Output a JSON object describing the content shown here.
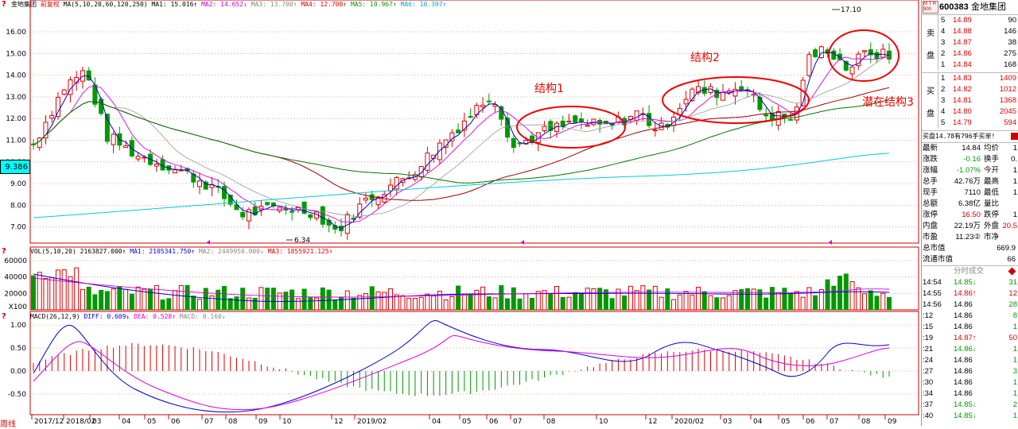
{
  "chart_header": {
    "stock_name": "金地集团",
    "adjust_flag": "前复权",
    "ma_label": "MA(5,10,20,60,120,250)",
    "ma1": "MA1: 15.016↑",
    "ma2": "MA2: 14.652↓",
    "ma3": "MA3: 13.700↑",
    "ma4": "MA4: 12.708↑",
    "ma5": "MA5: 10.967↑",
    "ma6": "MA6: 10.397↑"
  },
  "price_axis": [
    "16.00",
    "15.00",
    "14.00",
    "13.00",
    "12.00",
    "11.00",
    "10.00",
    "9.00",
    "8.00",
    "7.00"
  ],
  "current_price_tag": "9.386",
  "high_marker": "17.10",
  "low_marker": "6.34",
  "annotations": {
    "s1": "结构1",
    "s2": "结构2",
    "s3": "潜在结构3"
  },
  "vol_header": {
    "label": "VOL(5,10,20)",
    "vol": "2163827.000↑",
    "ma1": "MA1: 2105341.750↑",
    "ma2": "MA2: 2449950.000↓",
    "ma3": "MA3: 1855921.125↑"
  },
  "vol_axis": [
    "60000",
    "40000",
    "20000",
    "X100"
  ],
  "macd_header": {
    "label": "MACD(26,12,9)",
    "diff": "DIFF: 0.609↓",
    "dea": "DEA: 0.528↑",
    "macd": "MACD: 0.160↓"
  },
  "macd_axis": [
    "1.00",
    "0.50",
    "0.00",
    "-0.50"
  ],
  "time_axis": [
    {
      "label": "2017/12"
    },
    {
      "label": "2018/02"
    },
    {
      "label": "03"
    },
    {
      "label": "04"
    },
    {
      "label": "05"
    },
    {
      "label": "06"
    },
    {
      "label": "07"
    },
    {
      "label": "08"
    },
    {
      "label": "09"
    },
    {
      "label": "10"
    },
    {
      "label": "12"
    },
    {
      "label": "2019/02"
    },
    {
      "label": "04"
    },
    {
      "label": "05"
    },
    {
      "label": "06"
    },
    {
      "label": "07"
    },
    {
      "label": "08"
    },
    {
      "label": "10"
    },
    {
      "label": "12"
    },
    {
      "label": "2020/02"
    },
    {
      "label": "03"
    },
    {
      "label": "04"
    },
    {
      "label": "05"
    },
    {
      "label": "06"
    },
    {
      "label": "07"
    },
    {
      "label": "08"
    },
    {
      "label": "09"
    }
  ],
  "period_label": "周线",
  "side": {
    "code": "600383",
    "name": "金地集团",
    "sell_label_1": "卖",
    "sell_label_2": "盘",
    "buy_label_1": "买",
    "buy_label_2": "盘",
    "asks": [
      {
        "lvl": "5",
        "price": "14.89",
        "vol": "90"
      },
      {
        "lvl": "4",
        "price": "14.88",
        "vol": "146"
      },
      {
        "lvl": "3",
        "price": "14.87",
        "vol": "38"
      },
      {
        "lvl": "2",
        "price": "14.86",
        "vol": "275"
      },
      {
        "lvl": "1",
        "price": "14.84",
        "vol": "168"
      }
    ],
    "bids": [
      {
        "lvl": "1",
        "price": "14.83",
        "vol": "1409"
      },
      {
        "lvl": "2",
        "price": "14.82",
        "vol": "1012"
      },
      {
        "lvl": "3",
        "price": "14.81",
        "vol": "1368"
      },
      {
        "lvl": "4",
        "price": "14.80",
        "vol": "2045"
      },
      {
        "lvl": "5",
        "price": "14.79",
        "vol": "594"
      }
    ],
    "order_note": "买盘14.78有796手买单!",
    "stats": [
      {
        "k1": "最新",
        "v1": "14.84",
        "k2": "均价",
        "v2": "1"
      },
      {
        "k1": "涨跌",
        "v1": "-0.16",
        "k2": "换手",
        "v2": "0."
      },
      {
        "k1": "涨幅",
        "v1": "-1.07%",
        "k2": "今开",
        "v2": "1"
      },
      {
        "k1": "总手",
        "v1": "42.76万",
        "k2": "最高",
        "v2": "1"
      },
      {
        "k1": "现手",
        "v1": "7110",
        "k2": "最低",
        "v2": "1"
      },
      {
        "k1": "总额",
        "v1": "6.38亿",
        "k2": "量比",
        "v2": ""
      },
      {
        "k1": "涨停",
        "v1": "16.50",
        "k2": "跌停",
        "v2": "1"
      },
      {
        "k1": "内盘",
        "v1": "22.19万",
        "k2": "外盘",
        "v2": "20.5"
      },
      {
        "k1": "市盈",
        "v1": "11.23②",
        "k2": "市净",
        "v2": ""
      }
    ],
    "mktcap_label": "总市值",
    "mktcap_value": "669.9",
    "float_label": "流通市值",
    "float_value": "66",
    "ticks_title": "分时成交",
    "ticks": [
      {
        "t": "14:54",
        "p": "14.85↓",
        "v": "31"
      },
      {
        "t": "14:55",
        "p": "14.86↑",
        "v": "12"
      },
      {
        "t": "14:56",
        "p": "14.86",
        "v": "28"
      },
      {
        "t": ":12",
        "p": "14.86",
        "v": "8"
      },
      {
        "t": ":15",
        "p": "14.86",
        "v": "1"
      },
      {
        "t": ":19",
        "p": "14.87↑",
        "v": "50"
      },
      {
        "t": ":21",
        "p": "14.86↓",
        "v": "1"
      },
      {
        "t": ":24",
        "p": "14.86",
        "v": "1"
      },
      {
        "t": ":27",
        "p": "14.86",
        "v": "3"
      },
      {
        "t": ":30",
        "p": "14.86",
        "v": "1"
      },
      {
        "t": ":34",
        "p": "14.86",
        "v": "1"
      },
      {
        "t": ":37",
        "p": "14.85↓",
        "v": "2"
      },
      {
        "t": ":40",
        "p": "14.85↓",
        "v": "1"
      }
    ]
  },
  "colors": {
    "up": "#e00000",
    "down": "#009900",
    "ma_short": "#0000cc",
    "ma_magenta": "#dd00dd",
    "ma_long_green": "#007700",
    "ma_long_red": "#990000",
    "ma_cyan": "#00cccc"
  }
}
